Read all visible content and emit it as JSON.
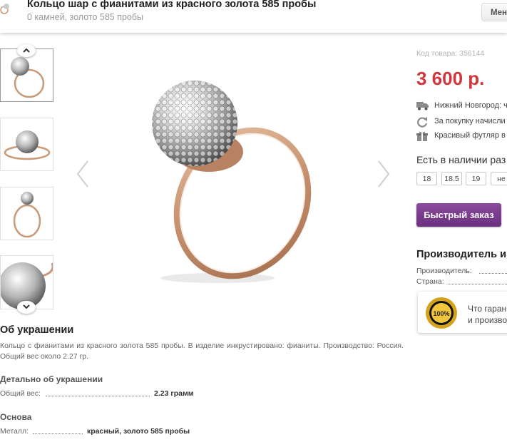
{
  "header": {
    "title": "Кольцо шар с фианитами из красного золота 585 пробы",
    "subtitle": "0 камней, золото 585 пробы",
    "menu_label": "Мен"
  },
  "product": {
    "sku_label": "Код товара: 356144",
    "price": "3 600 р.",
    "features": [
      {
        "icon": "truck-icon",
        "text": "Нижний Новгород: ч"
      },
      {
        "icon": "refresh-icon",
        "text": "За покупку начисли"
      },
      {
        "icon": "gift-icon",
        "text": "Красивый футляр в"
      }
    ],
    "availability_title": "Есть в наличии раз",
    "sizes": [
      "18",
      "18.5",
      "19",
      "не"
    ],
    "quick_order_label": "Быстрый заказ"
  },
  "manufacturer": {
    "title": "Производитель и",
    "producer_label": "Производитель:",
    "country_label": "Страна:"
  },
  "guarantee": {
    "badge_text": "100%",
    "line1": "Что гаран",
    "line2": "и производ"
  },
  "description": {
    "title": "Об украшении",
    "text": "Кольцо с фианитами из красного золота 585 пробы. В изделие инкрустировано: фианиты. Производство: Россия. Общий вес около 2.27 гр."
  },
  "details": {
    "title": "Детально об украшении",
    "weight_label": "Общий вес:",
    "weight_value": "2.23 грамм"
  },
  "base": {
    "title": "Основа",
    "metal_label": "Металл:",
    "metal_value": "красный, золото 585 пробы"
  },
  "colors": {
    "price": "#d0363c",
    "button": "#7a3a8e",
    "gold": "#c99a78"
  }
}
